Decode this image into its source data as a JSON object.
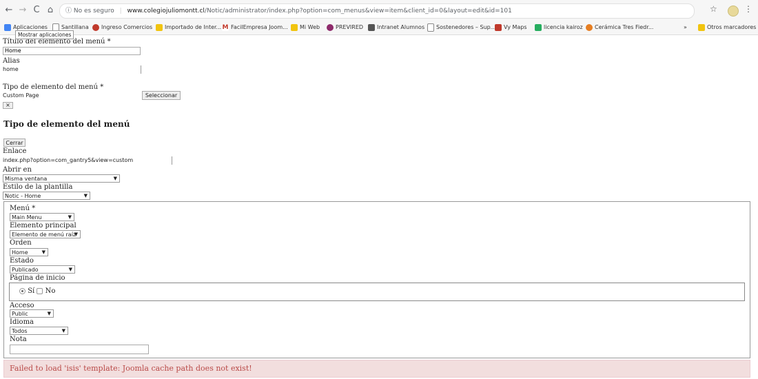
{
  "browser": {
    "nav": {
      "back": "←",
      "forward": "→",
      "reload": "C",
      "home": "⌂"
    },
    "security": "No es seguro",
    "url_host": "www.colegiojuliomontt.cl",
    "url_path": "/Notic/administrator/index.php?option=com_menus&view=item&client_id=0&layout=edit&id=101",
    "bookmarks": [
      {
        "label": "Aplicaciones",
        "color": "#4285f4"
      },
      {
        "label": "Santillana",
        "color": "#888888"
      },
      {
        "label": "Ingreso Comercios",
        "color": "#c0392b"
      },
      {
        "label": "Importado de Inter...",
        "color": "#f1c40f"
      },
      {
        "label": "FacilEmpresa Joom...",
        "color": "#c0392b"
      },
      {
        "label": "Mi Web",
        "color": "#f1c40f"
      },
      {
        "label": "PREVIRED",
        "color": "#8e2a6b"
      },
      {
        "label": "Intranet Alumnos",
        "color": "#555555"
      },
      {
        "label": "Sostenedores – Sup...",
        "color": "#888888"
      },
      {
        "label": "Vy Maps",
        "color": "#c0392b"
      },
      {
        "label": "licencia kairoz",
        "color": "#27ae60"
      },
      {
        "label": "Cerámica Tres Fiedr...",
        "color": "#e67e22"
      }
    ],
    "bookmarks_more": "»",
    "other_bookmarks": "Otros marcadores",
    "tooltip": "Mostrar aplicaciones"
  },
  "form": {
    "title_label": "Título del elemento del menú *",
    "title_value": "Home",
    "alias_label": "Alias",
    "alias_value": "home",
    "type_label": "Tipo de elemento del menú *",
    "type_value": "Custom Page",
    "select_button": "Seleccionar",
    "clear_button": "×"
  },
  "modal": {
    "heading": "Tipo de elemento del menú",
    "close_button": "Cerrar"
  },
  "link": {
    "label": "Enlace",
    "value": "index.php?option=com_gantry5&view=custom",
    "open_in_label": "Abrir en",
    "open_in_value": "Misma ventana",
    "template_style_label": "Estilo de la plantilla",
    "template_style_value": "Notic - Home"
  },
  "details": {
    "menu_label": "Menú *",
    "menu_value": "Main Menu",
    "parent_label": "Elemento principal",
    "parent_value": "Elemento de menú raíz",
    "order_label": "Orden",
    "order_value": "Home",
    "status_label": "Estado",
    "status_value": "Publicado",
    "home_label": "Página de inicio",
    "home_yes": "Sí",
    "home_no": "No",
    "access_label": "Acceso",
    "access_value": "Public",
    "language_label": "Idioma",
    "language_value": "Todos",
    "note_label": "Nota",
    "note_value": ""
  },
  "error": "Failed to load 'isis' template: Joomla cache path does not exist!"
}
